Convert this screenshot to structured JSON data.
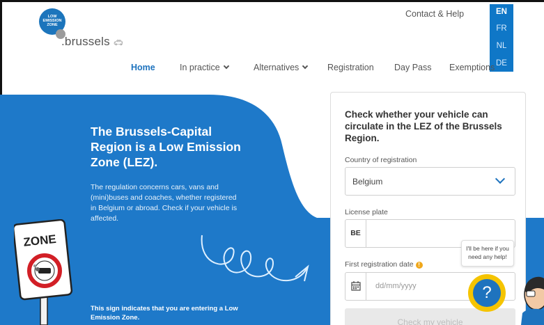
{
  "logo": {
    "circle_lines": [
      "LOW",
      "EMISSION",
      "ZONE"
    ],
    "wordmark": ".brussels"
  },
  "top": {
    "contact": "Contact & Help",
    "languages": [
      "EN",
      "FR",
      "NL",
      "DE"
    ],
    "active_language": "EN"
  },
  "nav": {
    "items": [
      "Home",
      "In practice",
      "Alternatives",
      "Registration",
      "Day Pass",
      "Exemptions"
    ],
    "active": "Home"
  },
  "hero": {
    "title": "The Brussels-Capital Region is a Low Emission Zone (LEZ).",
    "body": "The regulation concerns cars, vans and (mini)buses and coaches, whether registered in Belgium or abroad. Check if your vehicle is affected.",
    "sign_text": "ZONE",
    "sign_caption": "This sign indicates that you are entering a Low Emission Zone."
  },
  "form": {
    "title": "Check whether your vehicle can circulate in the LEZ of the Brussels Region.",
    "country_label": "Country of registration",
    "country_value": "Belgium",
    "plate_label": "License plate",
    "plate_prefix": "BE",
    "date_label": "First registration date",
    "date_placeholder": "dd/mm/yyyy",
    "submit": "Check my vehicle"
  },
  "help": {
    "bubble": "I'll be here if you need any help!",
    "button": "?"
  },
  "colors": {
    "brand_blue": "#1e73be",
    "hero_blue": "#1e79c9",
    "help_yellow": "#f5c400",
    "info_orange": "#f0a81c"
  }
}
